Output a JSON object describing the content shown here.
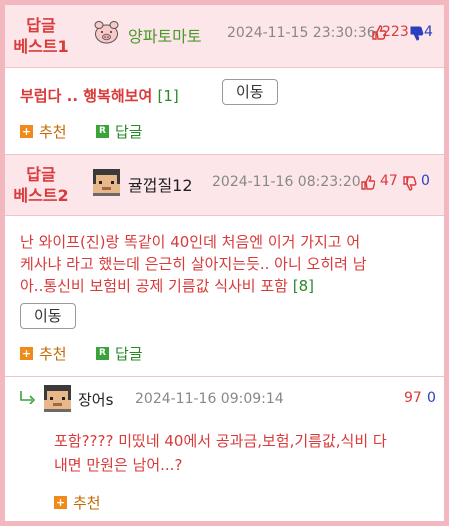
{
  "best1": {
    "label_line1": "답글",
    "label_line2": "베스트1",
    "nickname": "양파토마토",
    "datetime": "2024-11-15 23:30:36",
    "up_count": "223",
    "down_count": "4",
    "body": "부럽다 .. 행복해보여",
    "reply_count": "[1]",
    "move_label": "이동",
    "recommend_label": "추천",
    "reply_label": "답글",
    "nick_color": "#4a9a2a"
  },
  "best2": {
    "label_line1": "답글",
    "label_line2": "베스트2",
    "nickname": "귤껍질12",
    "datetime": "2024-11-16 08:23:20",
    "up_count": "47",
    "down_count": "0",
    "body_line1": "난 와이프(진)랑 똑같이 40인데 처음엔 이거 가지고 어",
    "body_line2": "케사냐 라고 했는데 은근히 살아지는듯.. 아니 오히려 남",
    "body_line3": "아..통신비 보험비 공제 기름값 식사비 포함",
    "reply_count": "[8]",
    "move_label": "이동",
    "recommend_label": "추천",
    "reply_label": "답글"
  },
  "reply": {
    "nickname": "장어s",
    "datetime": "2024-11-16 09:09:14",
    "up_count": "97",
    "down_count": "0",
    "body_line1": "포함???? 미띴네 40에서 공과금,보험,기름값,식비 다",
    "body_line2": "내면 만원은 남어...?",
    "recommend_label": "추천"
  },
  "icons": {
    "thumb_up": "thumb-up-icon",
    "thumb_down": "thumb-down-icon",
    "recommend": "plus-square-icon",
    "reply": "r-square-icon",
    "reply_arrow": "reply-arrow-icon"
  },
  "colors": {
    "accent_red": "#d93a3a",
    "pink_bg": "#fde6e9",
    "frame_pink": "#f3b7bf",
    "down_blue": "#2a3ec0",
    "green": "#2a8a2a",
    "orange": "#f08a1a"
  }
}
